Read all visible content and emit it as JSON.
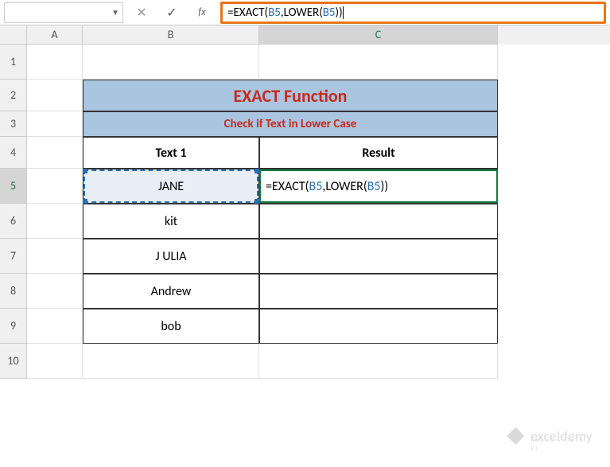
{
  "formula_bar": {
    "name_box": "",
    "formula_display": "=EXACT(B5,LOWER(B5))"
  },
  "columns": {
    "A": "A",
    "B": "B",
    "C": "C"
  },
  "rows": [
    "1",
    "2",
    "3",
    "4",
    "5",
    "6",
    "7",
    "8",
    "9",
    "10"
  ],
  "table": {
    "title": "EXACT Function",
    "subtitle": "Check if Text in Lower Case",
    "col1": "Text 1",
    "col2": "Result",
    "data": [
      "JANE",
      "kit",
      "J ULIA",
      "Andrew",
      "bob"
    ],
    "active_formula": "=EXACT(B5,LOWER(B5))"
  },
  "watermark": {
    "brand": "exceldemy",
    "tagline": "EXCEL • DATA • BI"
  },
  "chart_data": {
    "type": "table",
    "title": "EXACT Function — Check if Text in Lower Case",
    "columns": [
      "Text 1",
      "Result"
    ],
    "rows": [
      [
        "JANE",
        "=EXACT(B5,LOWER(B5))"
      ],
      [
        "kit",
        ""
      ],
      [
        "J ULIA",
        ""
      ],
      [
        "Andrew",
        ""
      ],
      [
        "bob",
        ""
      ]
    ]
  }
}
